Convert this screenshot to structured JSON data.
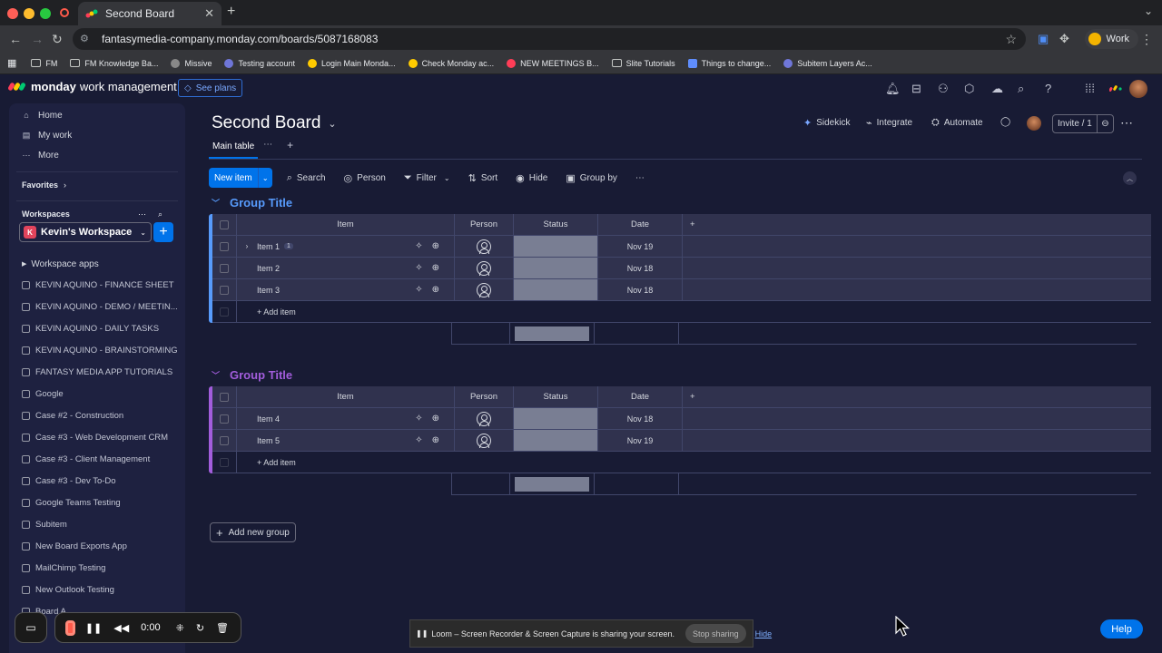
{
  "browser": {
    "tab_title": "Second Board",
    "url": "fantasymedia-company.monday.com/boards/5087168083",
    "profile_label": "Work",
    "bookmarks": [
      "FM",
      "FM Knowledge Ba...",
      "Missive",
      "Testing account",
      "Login Main Monda...",
      "Check Monday ac...",
      "NEW MEETINGS B...",
      "Slite Tutorials",
      "Things to change...",
      "Subitem Layers Ac..."
    ]
  },
  "app": {
    "brand_bold": "monday",
    "brand_rest": "work management",
    "see_plans": "See plans"
  },
  "sidebar": {
    "nav": [
      "Home",
      "My work",
      "More"
    ],
    "favorites": "Favorites",
    "workspaces": "Workspaces",
    "workspace_initial": "K",
    "workspace_name": "Kevin's Workspace",
    "workspace_apps": "Workspace apps",
    "boards": [
      "KEVIN AQUINO - FINANCE SHEET",
      "KEVIN AQUINO - DEMO / MEETIN...",
      "KEVIN AQUINO - DAILY TASKS",
      "KEVIN AQUINO - BRAINSTORMING",
      "FANTASY MEDIA APP TUTORIALS",
      "Google",
      "Case #2 - Construction",
      "Case #3 - Web Development CRM",
      "Case #3 - Client Management",
      "Case #3 - Dev To-Do",
      "Google Teams Testing",
      "Subitem",
      "New Board Exports App",
      "MailChimp Testing",
      "New Outlook Testing",
      "Board A"
    ]
  },
  "board": {
    "title": "Second Board",
    "sidekick": "Sidekick",
    "integrate": "Integrate",
    "automate": "Automate",
    "invite": "Invite / 1",
    "view_tab": "Main table",
    "new_item": "New item",
    "toolbar": [
      "Search",
      "Person",
      "Filter",
      "Sort",
      "Hide",
      "Group by"
    ],
    "columns": {
      "item": "Item",
      "person": "Person",
      "status": "Status",
      "date": "Date"
    },
    "add_item": "+ Add item",
    "add_group": "Add new group",
    "groups": [
      {
        "title": "Group Title",
        "color": "#579bfc",
        "rows": [
          {
            "name": "Item 1",
            "subitems": "1",
            "date": "Nov 19"
          },
          {
            "name": "Item 2",
            "date": "Nov 18"
          },
          {
            "name": "Item 3",
            "date": "Nov 18"
          }
        ]
      },
      {
        "title": "Group Title",
        "color": "#a25ddc",
        "rows": [
          {
            "name": "Item 4",
            "date": "Nov 18"
          },
          {
            "name": "Item 5",
            "date": "Nov 19"
          }
        ]
      }
    ]
  },
  "loom": {
    "timer": "0:00",
    "share_message": "Loom – Screen Recorder & Screen Capture is sharing your screen.",
    "stop_sharing": "Stop sharing",
    "hide": "Hide"
  },
  "help": "Help"
}
